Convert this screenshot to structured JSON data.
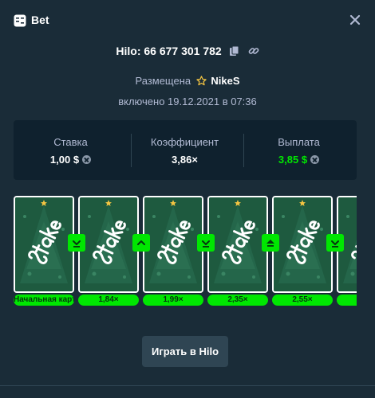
{
  "header": {
    "title": "Bet"
  },
  "bet": {
    "id_text": "Hilo: 66 677 301 782",
    "placed_label": "Размещена",
    "placed_user": "NikeS",
    "date_text": "включено 19.12.2021 в 07:36"
  },
  "stats": {
    "stake_label": "Ставка",
    "stake_value": "1,00 $",
    "multiplier_label": "Коэффициент",
    "multiplier_value": "3,86×",
    "payout_label": "Выплата",
    "payout_value": "3,85 $"
  },
  "cards": [
    {
      "label": "Начальная карта",
      "guess": null
    },
    {
      "label": "1,84×",
      "guess": "lower"
    },
    {
      "label": "1,99×",
      "guess": "higher"
    },
    {
      "label": "2,35×",
      "guess": "lower"
    },
    {
      "label": "2,55×",
      "guess": "higher-or-equal"
    },
    {
      "label": "",
      "guess": "lower"
    }
  ],
  "play_button_label": "Играть в Hilo",
  "colors": {
    "accent_green": "#00e701",
    "panel": "#0f212e",
    "background": "#1a2c38",
    "card_back": "#1e5a3f"
  }
}
